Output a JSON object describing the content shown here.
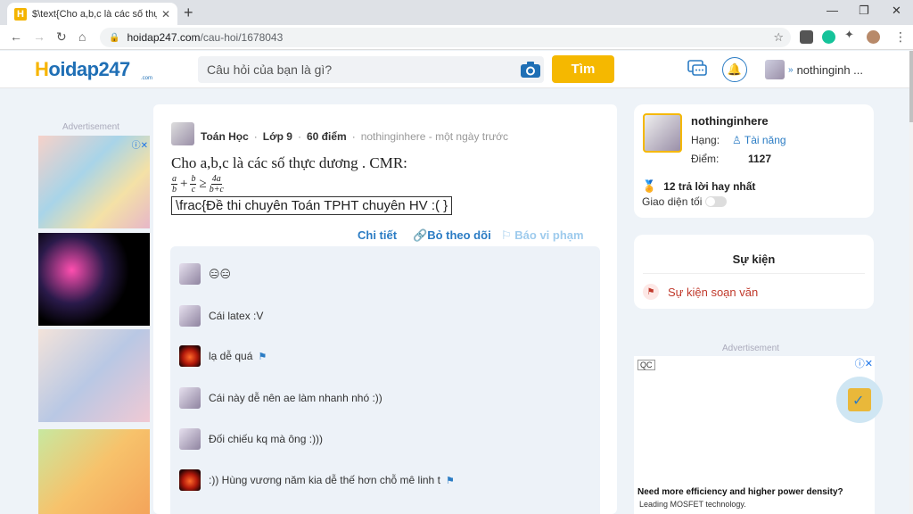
{
  "browser": {
    "tab_title": "$\\text{Cho a,b,c là các số thực dương . CMR: ...",
    "url_host": "hoidap247.com",
    "url_path": "/cau-hoi/1678043"
  },
  "site": {
    "logo_h": "H",
    "logo_rest": "oidap247",
    "logo_sub": ".com",
    "search_placeholder": "Câu hỏi của bạn là gì?",
    "search_button": "Tìm",
    "username": "nothinginh ..."
  },
  "ads": {
    "label": "Advertisement"
  },
  "question": {
    "subject": "Toán Học",
    "grade": "Lớp 9",
    "points": "60 điểm",
    "author_time": "nothinginhere - một ngày trước",
    "text": "Cho a,b,c là các số thực dương . CMR:",
    "formula": {
      "f1_num": "a",
      "f1_den": "b",
      "op_plus": "+",
      "f2_num": "b",
      "f2_den": "c",
      "op_geq": "≥",
      "f3_num": "4a",
      "f3_den": "b+c"
    },
    "boxed": "\\frac{Đề thi chuyên Toán TPHT chuyên HV :( }",
    "actions": {
      "detail": "Chi tiết",
      "unfollow": "Bỏ theo dõi",
      "report": "Báo vi phạm"
    }
  },
  "comments": [
    {
      "text": "😑😑",
      "avatar": "cat",
      "flag": false
    },
    {
      "text": "Cái latex :V",
      "avatar": "cat",
      "flag": false
    },
    {
      "text": "lạ dễ quá",
      "avatar": "fire",
      "flag": true
    },
    {
      "text": "Cái này dễ nên ae làm nhanh nhó :))",
      "avatar": "cat",
      "flag": false
    },
    {
      "text": "Đối chiếu kq mà ông :)))",
      "avatar": "cat",
      "flag": false
    },
    {
      "text": ":)) Hùng vương năm kia dễ thế hơn chỗ mê linh t",
      "avatar": "fire",
      "flag": true
    }
  ],
  "profile": {
    "name": "nothinginhere",
    "rank_label": "Hạng:",
    "rank": "Tài năng",
    "points_label": "Điểm:",
    "points": "1127",
    "best_answers": "12 trả lời hay nhất",
    "dark_mode": "Giao diện tối"
  },
  "events": {
    "title": "Sự kiện",
    "item": "Sự kiện soạn văn"
  },
  "ad_right": {
    "qc": "QC",
    "headline": "Need more efficiency and higher power density?",
    "sub": "Leading MOSFET technology."
  },
  "colors": {
    "brand_yellow": "#f5b800",
    "brand_blue": "#2b7cc4"
  }
}
